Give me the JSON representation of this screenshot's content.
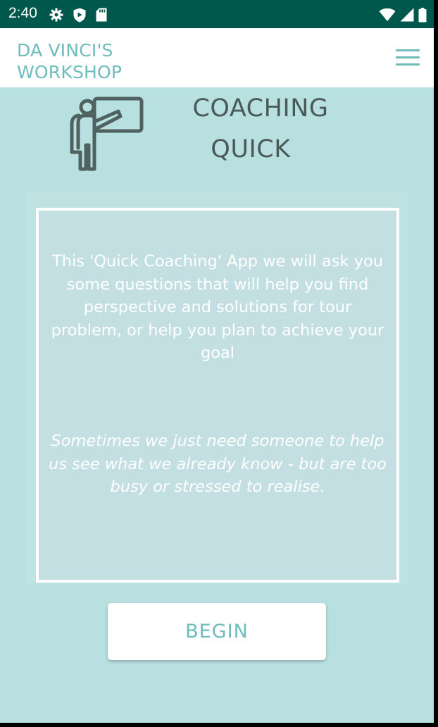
{
  "status_bar": {
    "time": "2:40",
    "icons_left": [
      "settings-icon",
      "shield-icon",
      "sd-card-icon"
    ],
    "icons_right": [
      "wifi-icon",
      "signal-icon",
      "battery-icon"
    ],
    "background": "#00574b"
  },
  "app_bar": {
    "title_line1": "DA VINCI'S",
    "title_line2": "WORKSHOP",
    "menu_icon": "hamburger-menu-icon",
    "accent_color": "#6fbcbc"
  },
  "header": {
    "icon": "teacher-presentation-icon",
    "title_line1": "COACHING",
    "title_line2": "QUICK"
  },
  "panel": {
    "intro": "This 'Quick Coaching' App we will ask you some questions that will help you find perspective and solutions for tour problem, or help you plan to achieve your goal",
    "quote": "Sometimes we just need someone to help us see what we already know - but are too busy or stressed to realise."
  },
  "begin_button": {
    "label": "BEGIN"
  },
  "colors": {
    "background": "#b8e0e0",
    "panel": "#c3dfe2",
    "title_text": "#4a5a58"
  }
}
